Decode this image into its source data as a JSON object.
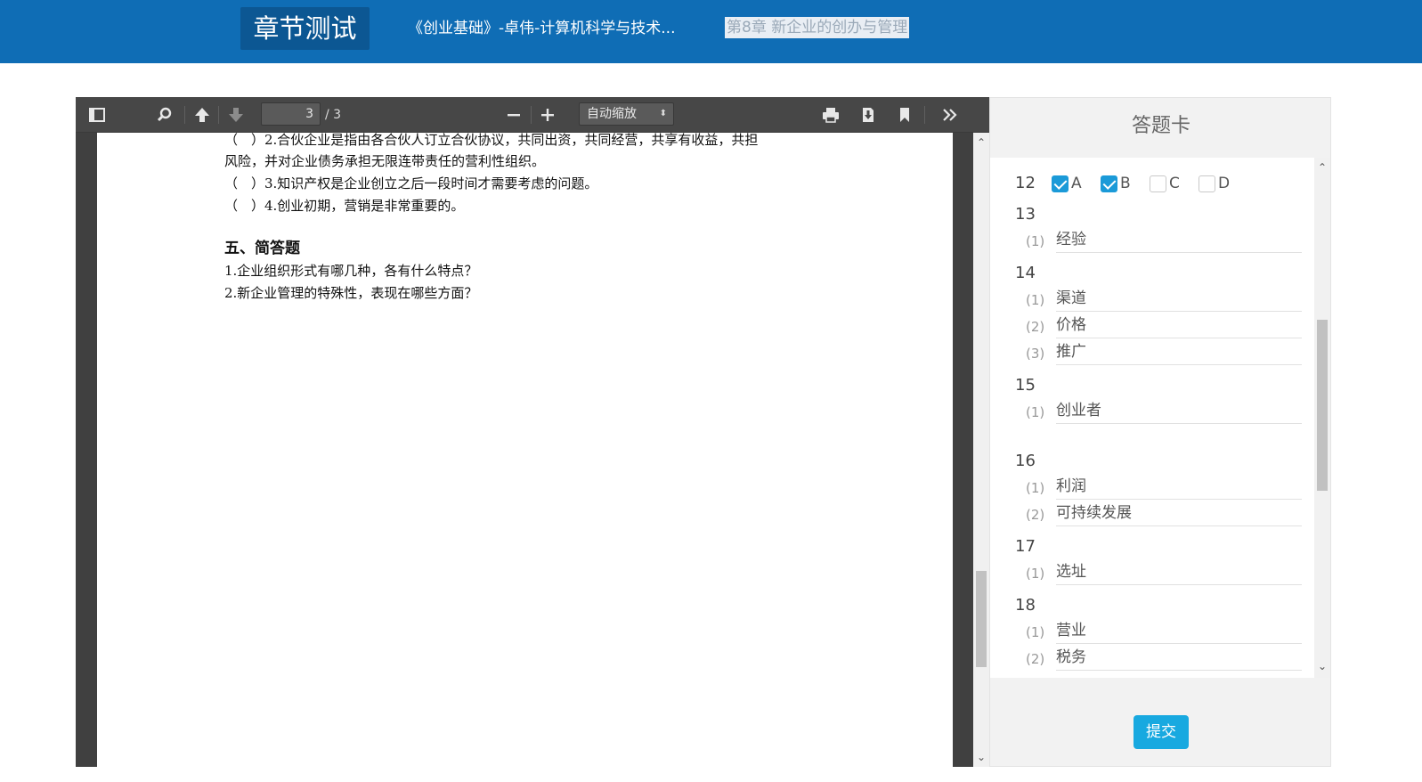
{
  "header": {
    "brand": "章节测试",
    "course": "《创业基础》-卓伟-计算机科学与技术...",
    "chapter": "第8章 新企业的创办与管理"
  },
  "viewer": {
    "toolbar": {
      "page_current": "3",
      "page_total": "/ 3",
      "zoom": "自动缩放"
    },
    "lines": [
      "（　）2.合伙企业是指由各合伙人订立合伙协议，共同出资，共同经营，共享有收益，共担",
      "风险，并对企业债务承担无限连带责任的营利性组织。",
      "（　）3.知识产权是企业创立之后一段时间才需要考虑的问题。",
      "（　）4.创业初期，营销是非常重要的。"
    ],
    "section_heading": "五、简答题",
    "questions": [
      "1.企业组织形式有哪几种，各有什么特点？",
      "2.新企业管理的特殊性，表现在哪些方面？"
    ]
  },
  "card": {
    "title": "答题卡",
    "q12": {
      "number": "12",
      "options": [
        {
          "label": "A",
          "checked": true
        },
        {
          "label": "B",
          "checked": true
        },
        {
          "label": "C",
          "checked": false
        },
        {
          "label": "D",
          "checked": false
        }
      ]
    },
    "items": [
      {
        "number": "13",
        "answers": [
          {
            "idx": "(1)",
            "value": "经验"
          }
        ]
      },
      {
        "number": "14",
        "answers": [
          {
            "idx": "(1)",
            "value": "渠道"
          },
          {
            "idx": "(2)",
            "value": "价格"
          },
          {
            "idx": "(3)",
            "value": "推广"
          }
        ]
      },
      {
        "number": "15",
        "answers": [
          {
            "idx": "(1)",
            "value": "创业者"
          }
        ]
      },
      {
        "number": "16",
        "answers": [
          {
            "idx": "(1)",
            "value": "利润"
          },
          {
            "idx": "(2)",
            "value": "可持续发展"
          }
        ]
      },
      {
        "number": "17",
        "answers": [
          {
            "idx": "(1)",
            "value": "选址"
          }
        ]
      },
      {
        "number": "18",
        "answers": [
          {
            "idx": "(1)",
            "value": "营业"
          },
          {
            "idx": "(2)",
            "value": "税务"
          }
        ]
      }
    ],
    "submit_label": "提交"
  },
  "colors": {
    "header_bg": "#0f6db5",
    "accent": "#18a9e0",
    "checkbox_on": "#1b9ad8"
  }
}
